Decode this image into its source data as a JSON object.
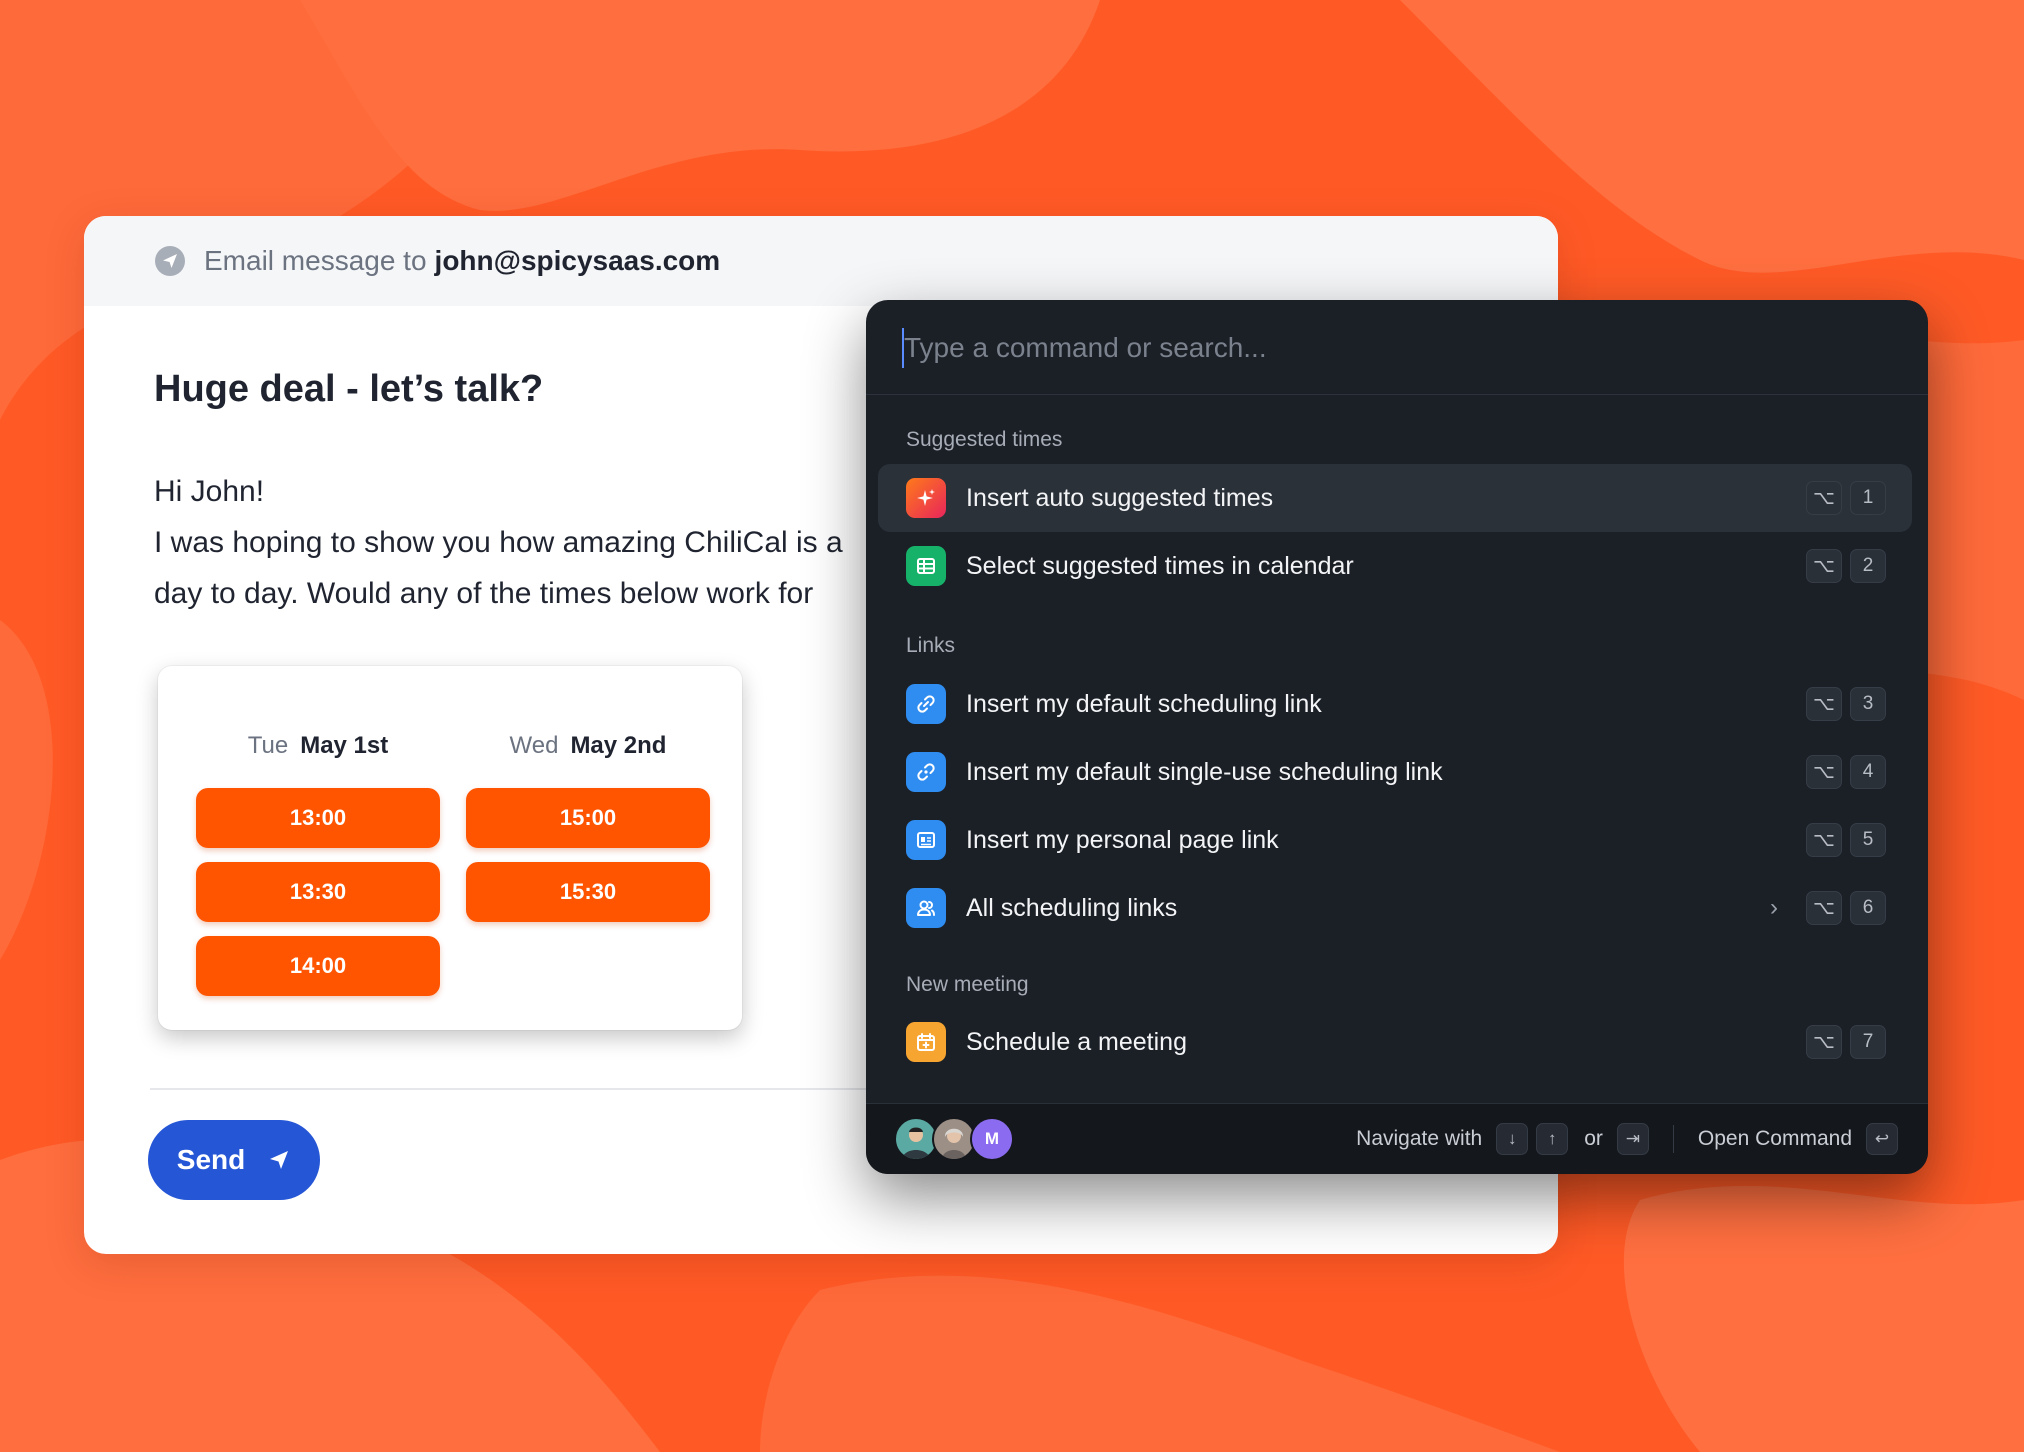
{
  "email": {
    "header_prefix": "Email message to",
    "recipient": "john@spicysaas.com",
    "subject": "Huge deal - let’s talk?",
    "greeting": "Hi John!",
    "body_line1": "I was hoping to show you how amazing ChiliCal is a",
    "body_line2": "day to day. Would any of the times below work for",
    "send_label": "Send",
    "days": [
      {
        "name": "Tue",
        "date": "May 1st",
        "slots": [
          "13:00",
          "13:30",
          "14:00"
        ]
      },
      {
        "name": "Wed",
        "date": "May 2nd",
        "slots": [
          "15:00",
          "15:30"
        ]
      }
    ],
    "accent_color": "#ff5500",
    "send_color": "#2456d6"
  },
  "palette": {
    "search_placeholder": "Type a command or search...",
    "sections": {
      "suggested": "Suggested times",
      "links": "Links",
      "new_meeting": "New meeting"
    },
    "items": [
      {
        "label": "Insert auto suggested times",
        "icon": "sparkle-icon",
        "color": "#f0452f",
        "key": "1"
      },
      {
        "label": "Select suggested times in calendar",
        "icon": "calendar-grid-icon",
        "color": "#17b26a",
        "key": "2"
      },
      {
        "label": "Insert my default scheduling link",
        "icon": "link-icon",
        "color": "#2f8cf0",
        "key": "3"
      },
      {
        "label": "Insert my default single-use scheduling link",
        "icon": "single-use-link-icon",
        "color": "#2f8cf0",
        "key": "4"
      },
      {
        "label": "Insert my personal page link",
        "icon": "personal-page-icon",
        "color": "#2f8cf0",
        "key": "5"
      },
      {
        "label": "All scheduling links",
        "icon": "users-icon",
        "color": "#2f8cf0",
        "key": "6"
      },
      {
        "label": "Schedule a meeting",
        "icon": "calendar-plus-icon",
        "color": "#f7a531",
        "key": "7"
      }
    ],
    "option_key": "⌥",
    "footer": {
      "avatar_initial": "M",
      "navigate": "Navigate with",
      "down_key": "↓",
      "up_key": "↑",
      "or": "or",
      "tab_key": "⇥",
      "open_command": "Open Command",
      "enter_key": "↩"
    }
  }
}
